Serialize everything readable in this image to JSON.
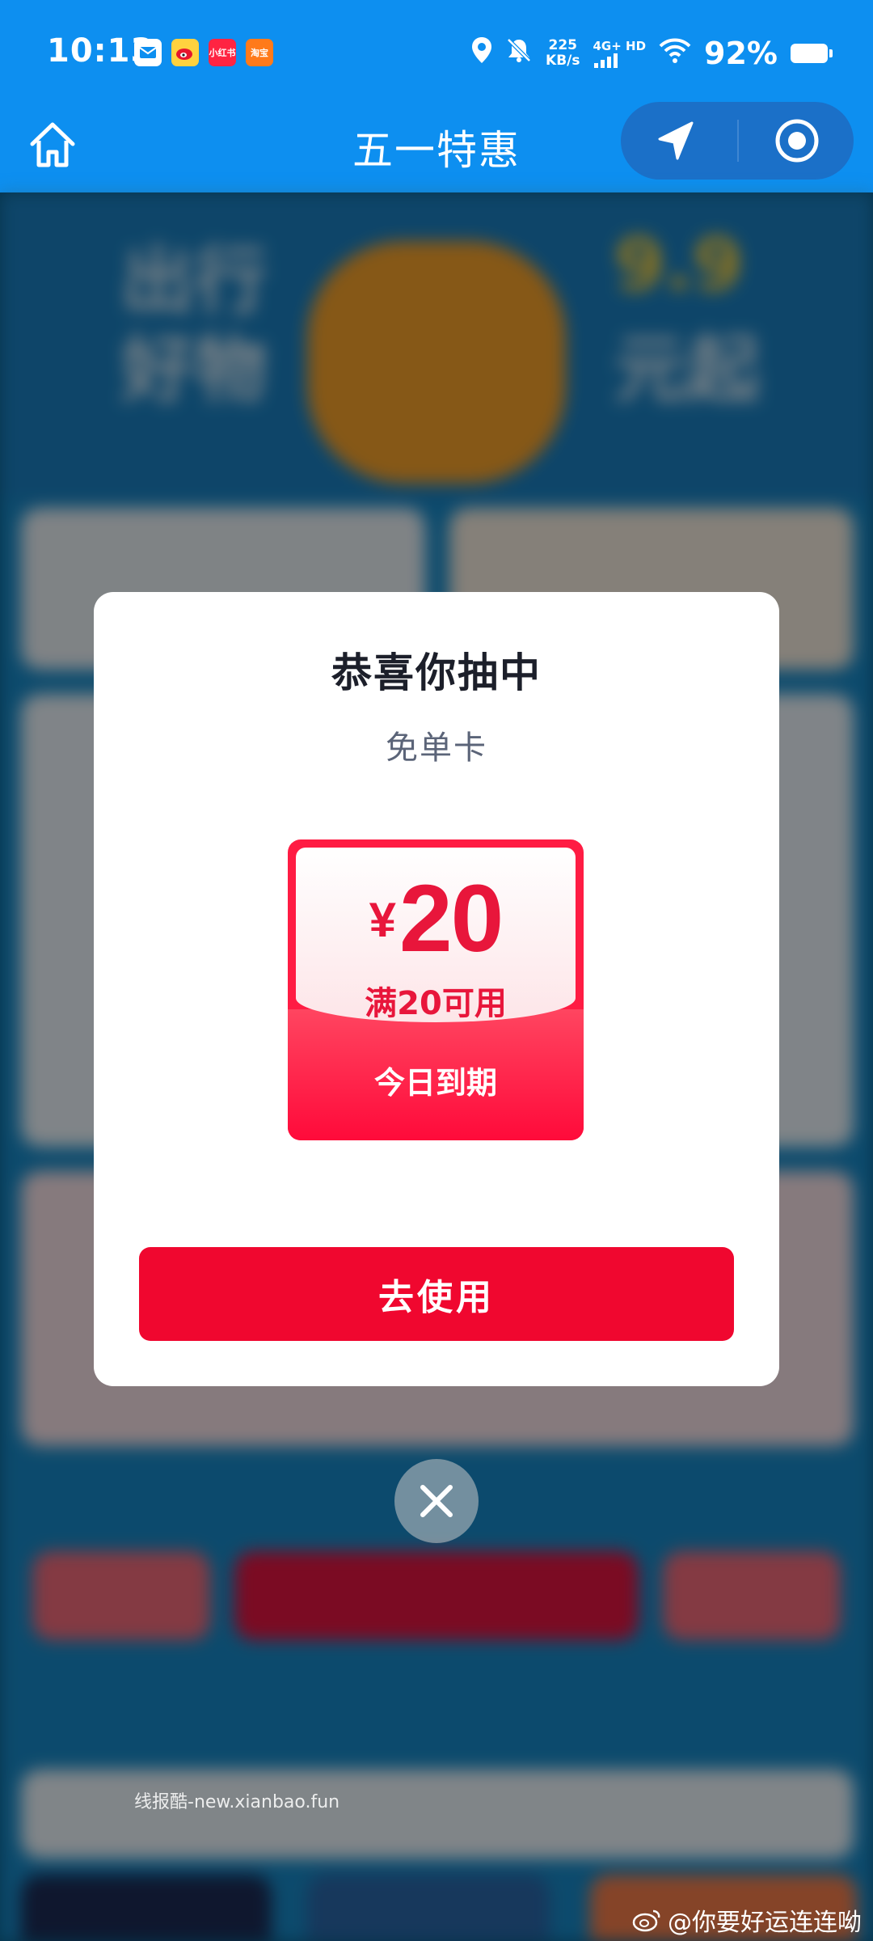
{
  "status_bar": {
    "time": "10:13",
    "speed_value": "225",
    "speed_unit": "KB/s",
    "network_top": "4G+ HD",
    "battery": "92%",
    "app_icon_2": "小红书",
    "app_icon_3": "淘宝"
  },
  "header": {
    "title": "五一特惠"
  },
  "background": {
    "banner_left_1": "出行",
    "banner_left_2": "好物",
    "banner_right_1": "9.9",
    "banner_right_2": "元起"
  },
  "modal": {
    "title": "恭喜你抽中",
    "subtitle": "免单卡",
    "coupon": {
      "currency": "¥",
      "amount": "20",
      "condition": "满20可用",
      "expiry": "今日到期"
    },
    "use_button": "去使用"
  },
  "watermarks": {
    "left": "线报酷-new.xianbao.fun",
    "right": "@你要好运连连呦"
  },
  "colors": {
    "status_bar": "#0d8ff0",
    "accent_red": "#f0072f",
    "coupon_text": "#e8163b"
  }
}
